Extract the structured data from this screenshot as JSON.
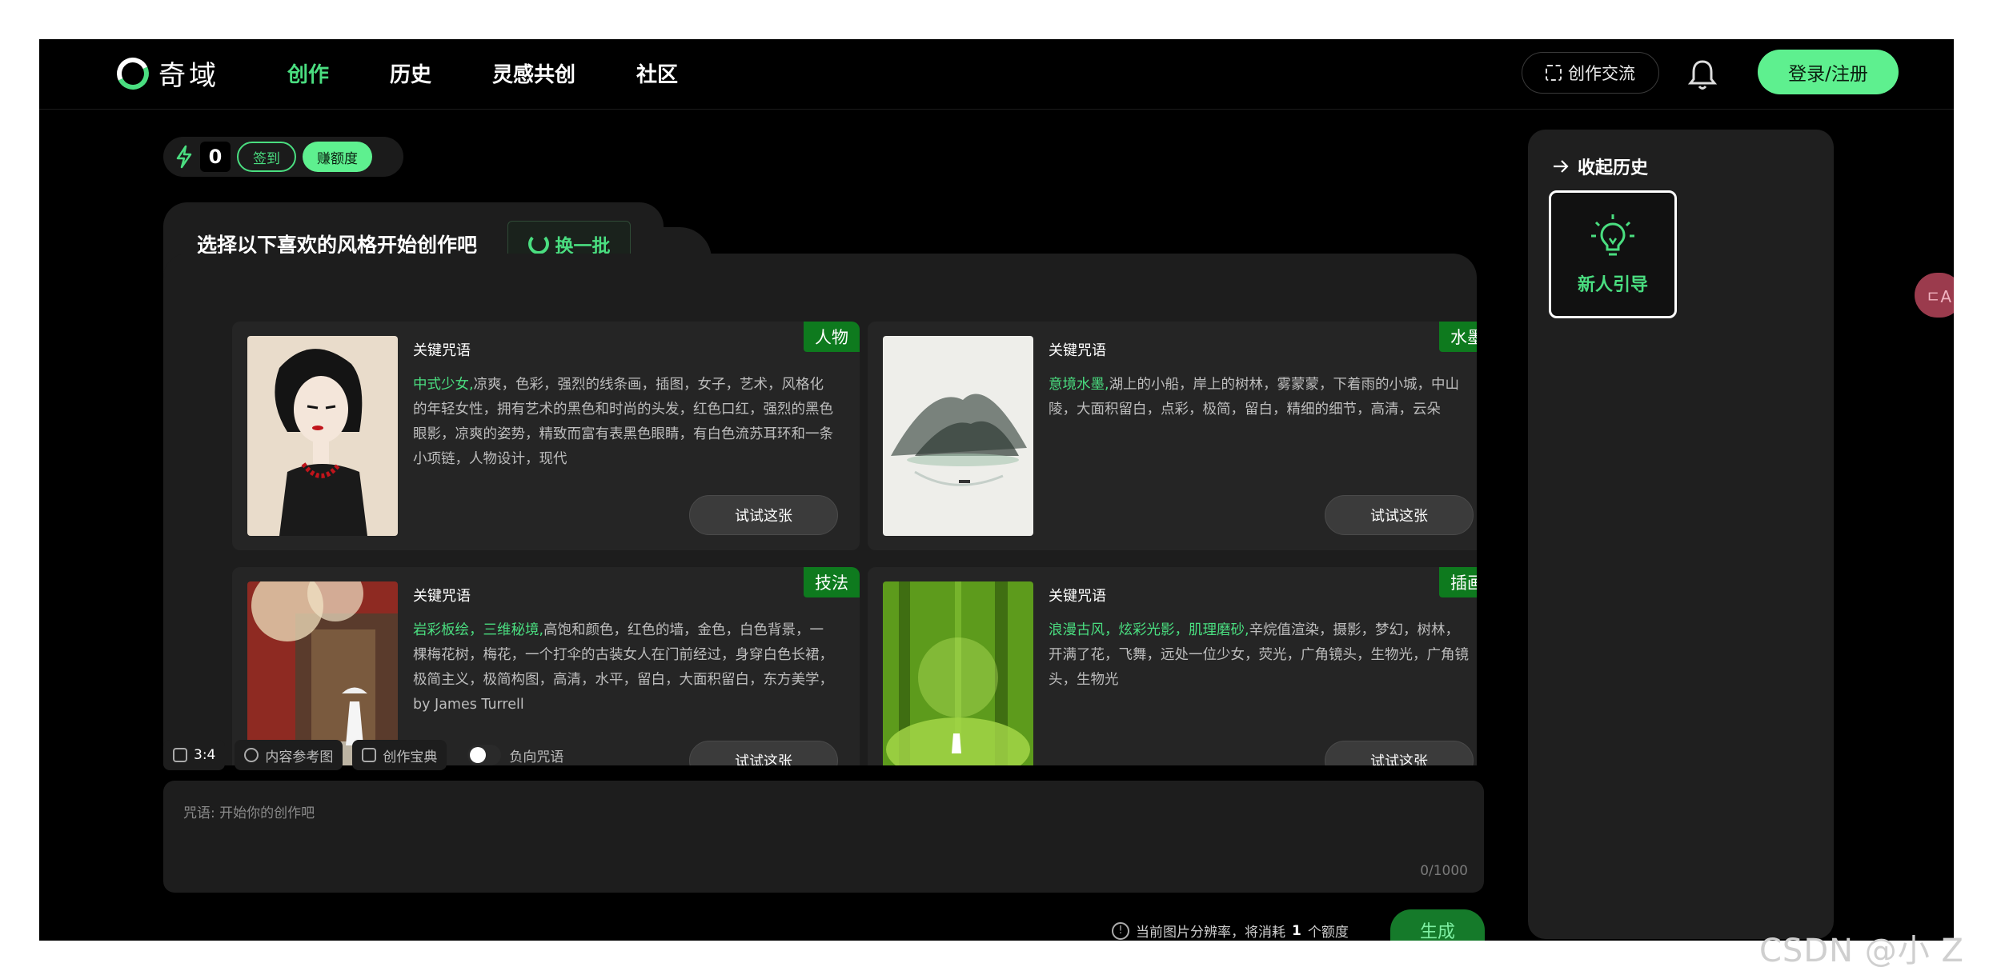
{
  "app": {
    "name": "奇域"
  },
  "nav": {
    "items": [
      {
        "label": "创作",
        "active": true
      },
      {
        "label": "历史",
        "active": false
      },
      {
        "label": "灵感共创",
        "active": false
      },
      {
        "label": "社区",
        "active": false
      }
    ],
    "exchange_label": "创作交流",
    "login_label": "登录/注册"
  },
  "credits": {
    "count": "0",
    "signin_label": "签到",
    "earn_label": "赚额度"
  },
  "style_panel": {
    "title": "选择以下喜欢的风格开始创作吧",
    "refresh_label": "换一批",
    "cards": [
      {
        "tag": "人物",
        "keyword_label": "关键咒语",
        "highlight": "中式少女,",
        "desc": "凉爽，色彩，强烈的线条画，插图，女子，艺术，风格化的年轻女性，拥有艺术的黑色和时尚的头发，红色口红，强烈的黑色眼影，凉爽的姿势，精致而富有表黑色眼睛，有白色流苏耳环和一条小项链，人物设计，现代",
        "try_label": "试试这张"
      },
      {
        "tag": "水墨",
        "keyword_label": "关键咒语",
        "highlight": "意境水墨,",
        "desc": "湖上的小船，岸上的树林，雾蒙蒙，下着雨的小城，中山陵，大面积留白，点彩，极简，留白，精细的细节，高清，云朵",
        "try_label": "试试这张"
      },
      {
        "tag": "技法",
        "keyword_label": "关键咒语",
        "highlight": "岩彩板绘，三维秘境,",
        "desc": "高饱和颜色，红色的墙，金色，白色背景，一棵梅花树，梅花，一个打伞的古装女人在门前经过，身穿白色长裙，极简主义，极简构图，高清，水平，留白，大面积留白，东方美学，by James Turrell",
        "try_label": "试试这张"
      },
      {
        "tag": "插画",
        "keyword_label": "关键咒语",
        "highlight": "浪漫古风，炫彩光影，肌理磨砂,",
        "desc": "辛烷值渲染，摄影，梦幻，树林，开满了花，飞舞，远处一位少女，荧光，广角镜头，生物光，广角镜头，生物光",
        "try_label": "试试这张"
      }
    ]
  },
  "toolbar": {
    "ratio": "3:4",
    "reference_label": "内容参考图",
    "guide_label": "创作宝典",
    "negative_label": "负向咒语"
  },
  "prompt": {
    "placeholder": "咒语: 开始你的创作吧",
    "counter": "0/1000"
  },
  "cost_note": {
    "prefix": "当前图片分辨率，将消耗",
    "amount": "1",
    "suffix": "个额度"
  },
  "generate_label": "生成",
  "history": {
    "collapse_label": "收起历史",
    "guide_label": "新人引导"
  },
  "float_label": "ㄷA",
  "watermark": "CSDN @小 Z",
  "colors": {
    "accent": "#4ade80",
    "tag_bg": "#0e7a1e",
    "background": "#000000"
  }
}
